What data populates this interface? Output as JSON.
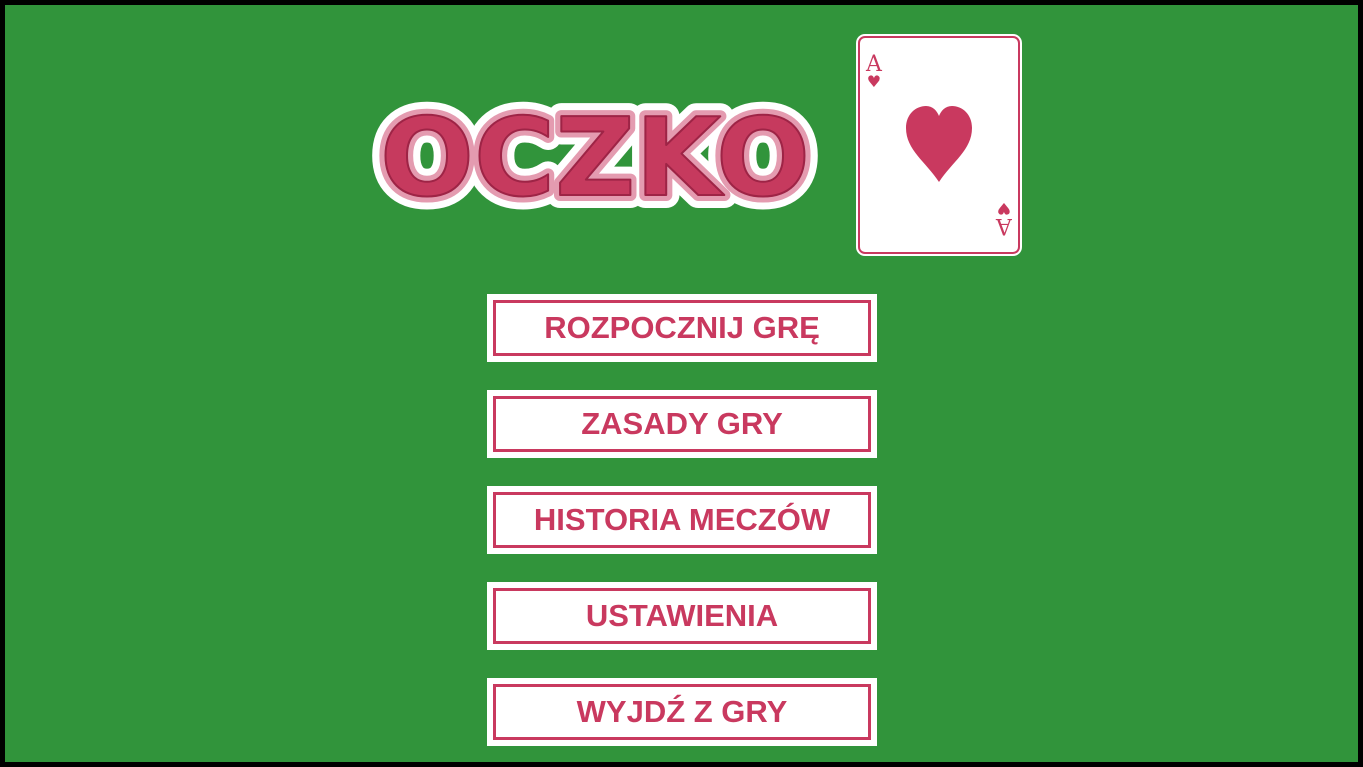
{
  "game": {
    "title": "OCZKO",
    "background_color": "#31943b",
    "accent_color": "#c9395f"
  },
  "card": {
    "rank": "A",
    "suit_icon": "heart-icon",
    "suit_glyph": "♥"
  },
  "menu": {
    "items": [
      {
        "label": "ROZPOCZNIJ GRĘ"
      },
      {
        "label": "ZASADY GRY"
      },
      {
        "label": "HISTORIA MECZÓW"
      },
      {
        "label": "USTAWIENIA"
      },
      {
        "label": "WYJDŹ Z GRY"
      }
    ]
  }
}
